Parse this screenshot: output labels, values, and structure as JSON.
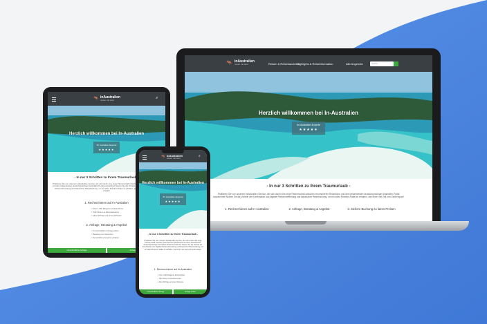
{
  "brand": {
    "name": "in-Australien",
    "name_in": "in",
    "name_main": "Australien",
    "tagline": "reisen mit Herz",
    "accent": "#3da93d",
    "bg_blue": "#4f86e0"
  },
  "nav": {
    "items": [
      "Reisen & Reisebausteine",
      "Highlights & Reiseinformation",
      "Alle Angebote"
    ],
    "search_placeholder": "Suche..."
  },
  "hero": {
    "title": "Herzlich willkommen bei In-Australien",
    "experts": "Ihr Australien-Experte",
    "stars": "★★★★★"
  },
  "section": {
    "title": "- In nur 3 Schritten zu Ihrem Traumurlaub -",
    "tablet_title": "- In nur 3 Schritten zu Ihrem Traumurlaub -",
    "intro": "Profitieren Sie von unserem individuellen Service, der sich durch eine enge Partnerschaft zwischen renommierten Reisebüros und dem bekanntesten deutschsprachigen Australien-Portal auszeichnet! Nutzen Sie die Vorteile der Kombination aus digitaler Reisevorbereitung und klassischer Reisebuchung, um ein tolles Rundum-Paket zu erhalten, das Ihnen viel Zeit und Geld erspart!",
    "steps": [
      "1. Recherchieren auf In-Australien",
      "2. Anfrage, Beratung & Angebot",
      "3. Sichere Buchung zu fairen Preisen"
    ],
    "step1_checks": [
      "Über 1.000 Ratgeber & Reiseführer",
      "Tolle Reisen & Reisebausteine",
      "Alles Wichtige auf einer Webseite"
    ],
    "step2_checks": [
      "Unverbindliche Anfrage stellen",
      "Beratung vom Experten",
      "Persönliches Angebot erhalten"
    ]
  },
  "bottom_bar": {
    "left": "Unverbindliche Anfrage",
    "right": "Anfrage stellen"
  }
}
